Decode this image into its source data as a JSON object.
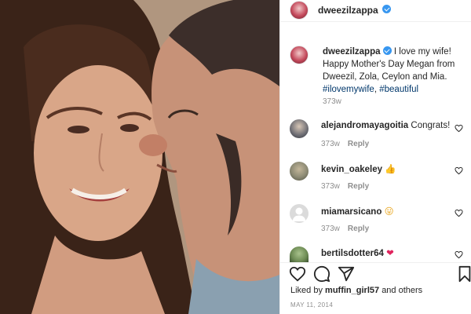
{
  "post": {
    "username": "dweezilzappa",
    "verified": true,
    "photo_icon": "post-photo",
    "caption_username": "dweezilzappa",
    "caption_text": "I love my wife! Happy Mother's Day Megan from Dweezil, Zola, Ceylon and Mia.",
    "hashtag_1": "#ilovemywife",
    "hashtag_2": "#beautiful",
    "age": "373w"
  },
  "comments": [
    {
      "username": "alejandromayagoitia",
      "text": "Congrats!",
      "emoji": "",
      "age": "373w",
      "reply": "Reply"
    },
    {
      "username": "kevin_oakeley",
      "text": "",
      "emoji": "👍",
      "age": "373w",
      "reply": "Reply"
    },
    {
      "username": "miamarsicano",
      "text": "",
      "emoji": "😛",
      "age": "373w",
      "reply": "Reply"
    },
    {
      "username": "bertilsdotter64",
      "text": "",
      "emoji": "❤",
      "age": "",
      "reply": ""
    }
  ],
  "actions": {
    "like_icon": "heart-icon",
    "comment_icon": "comment-icon",
    "share_icon": "share-icon",
    "save_icon": "bookmark-icon"
  },
  "likes": {
    "prefix": "Liked by",
    "user": "muffin_girl57",
    "suffix": "and others"
  },
  "date": "MAY 11, 2014",
  "colors": {
    "verified": "#3897f0",
    "hashtag": "#00376b",
    "secondary_text": "#8e8e8e",
    "heart_emoji": "#e0245e"
  }
}
